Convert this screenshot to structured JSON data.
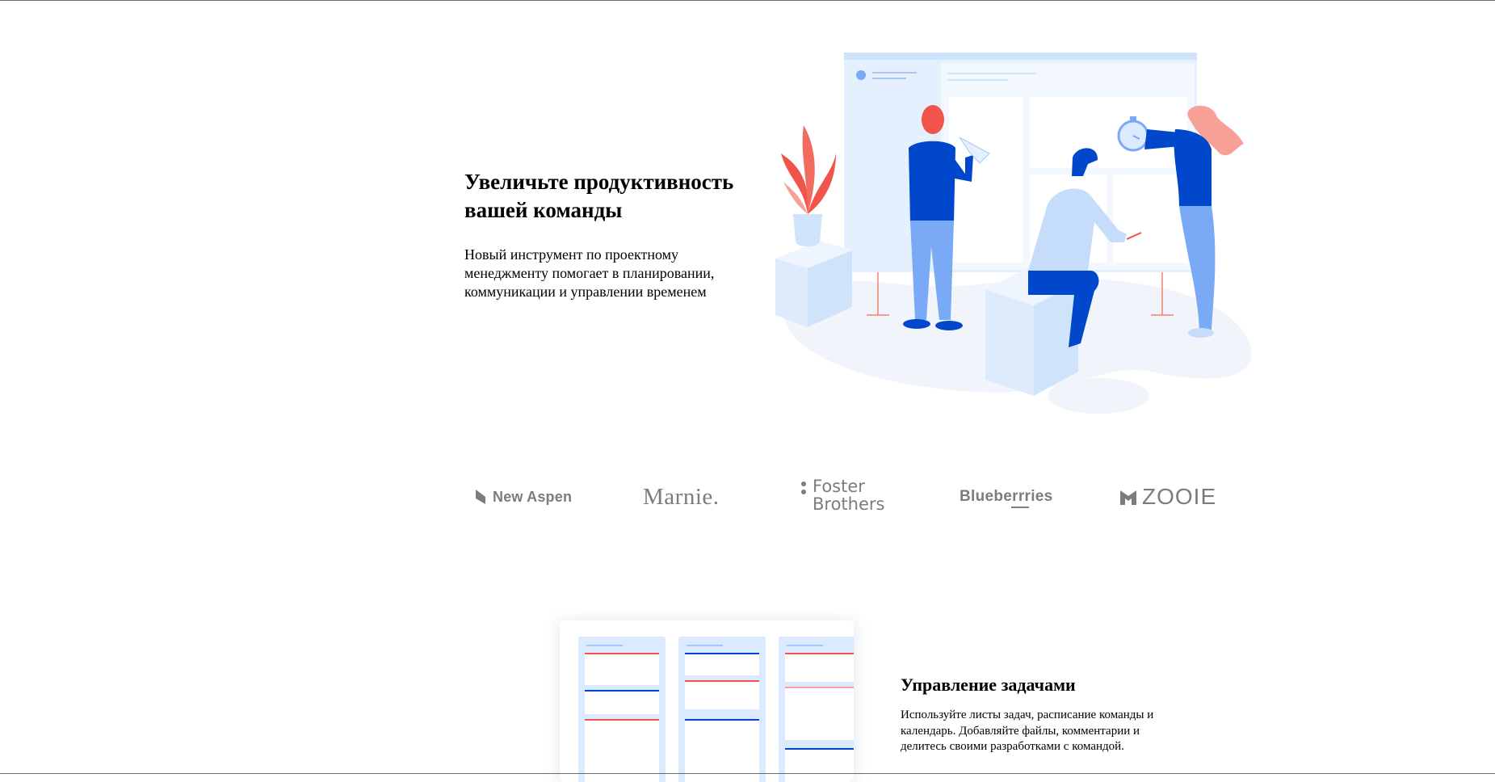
{
  "hero": {
    "title": "Увеличьте продуктивность вашей команды",
    "description": "Новый инструмент по проектному менеджменту помогает в планировании, коммуникации и управлении временем"
  },
  "logos": {
    "new_aspen": "New Aspen",
    "marnie": "Marnie.",
    "foster_line1": "Foster",
    "foster_line2": "Brothers",
    "blueberries": "Blueberrries",
    "zooie": "ZOOIE"
  },
  "feature": {
    "title": "Управление задачами",
    "description": "Используйте листы задач, расписание команды и календарь. Добавляйте файлы, комментарии и делитесь своими разработками с командой."
  },
  "colors": {
    "primary_blue": "#0047cc",
    "light_blue": "#dbeaff",
    "accent_red": "#f0544a",
    "logo_gray": "#7c7c7c"
  }
}
